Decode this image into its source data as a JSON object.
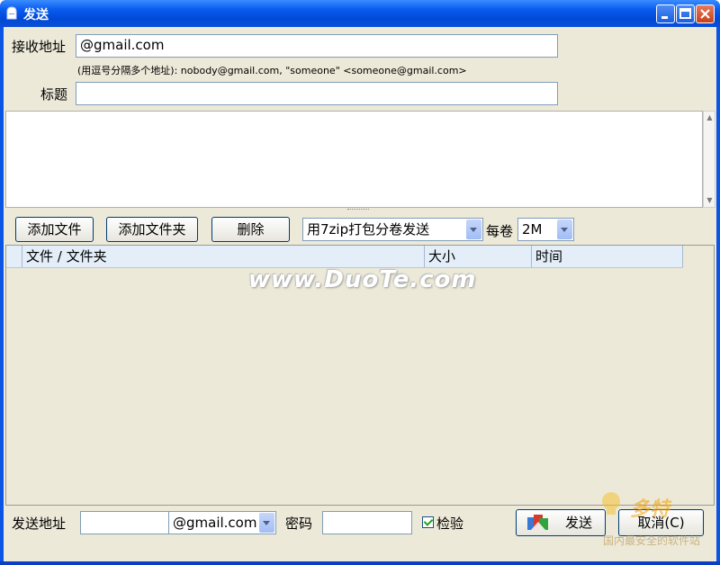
{
  "window": {
    "title": "发送"
  },
  "to": {
    "label": "接收地址",
    "value": "@gmail.com",
    "hint": "(用逗号分隔多个地址):   nobody@gmail.com, \"someone\" <someone@gmail.com>"
  },
  "subject": {
    "label": "标题",
    "value": ""
  },
  "toolbar": {
    "add_file": "添加文件",
    "add_folder": "添加文件夹",
    "delete": "删除",
    "pack_mode": "用7zip打包分卷发送",
    "per_volume_label": "每卷",
    "volume_size": "2M"
  },
  "file_list": {
    "columns": [
      "文件 / 文件夹",
      "大小",
      "时间"
    ]
  },
  "watermark": "www.DuoTe.com",
  "sender": {
    "label": "发送地址",
    "value": "",
    "domain": "@gmail.com",
    "password_label": "密码",
    "password": "",
    "verify_label": "检验",
    "verify_checked": true
  },
  "actions": {
    "send": "发送",
    "cancel": "取消(C)"
  },
  "corner_logo": {
    "brand": "多特",
    "tagline": "国内最安全的软件站"
  },
  "colors": {
    "titlebar": "#0a55e3",
    "client": "#ece9d8",
    "header": "#e3eef9"
  }
}
